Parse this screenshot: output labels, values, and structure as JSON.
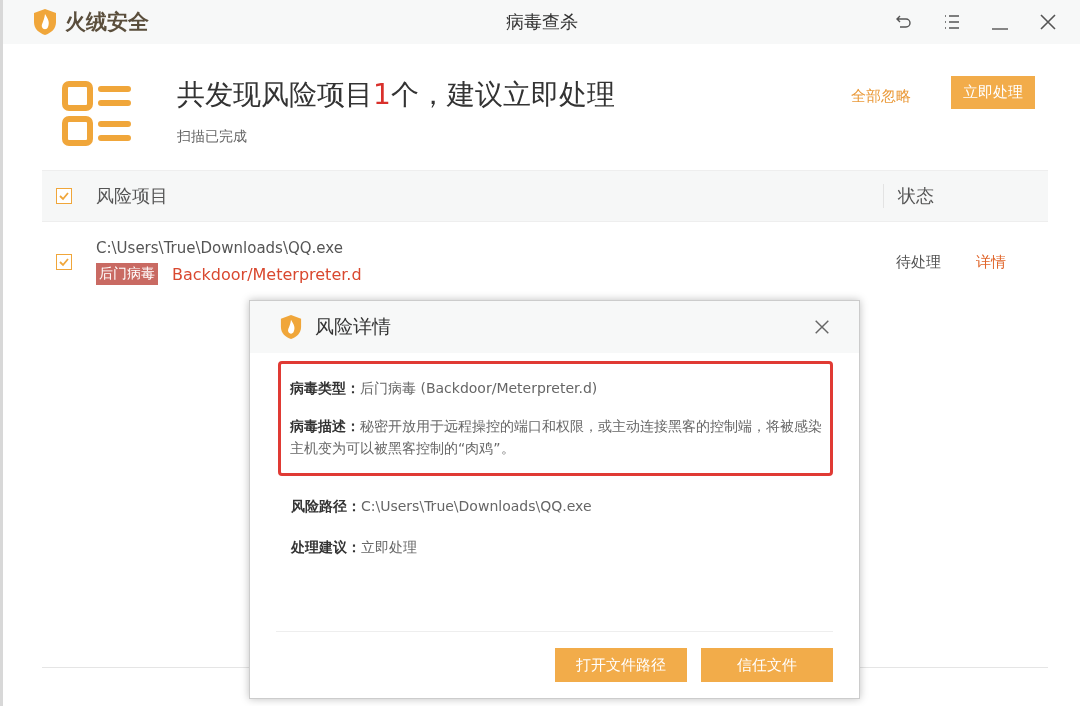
{
  "window": {
    "brand": "火绒安全",
    "title": "病毒查杀"
  },
  "summary": {
    "title_before": "共发现风险项目",
    "count": "1",
    "title_after": "个，建议立即处理",
    "subtitle": "扫描已完成"
  },
  "actions": {
    "ignore_all": "全部忽略",
    "process_now": "立即处理"
  },
  "table": {
    "header_checked": true,
    "columns": [
      "风险项目",
      "状态"
    ],
    "rows": [
      {
        "checked": true,
        "path": "C:\\Users\\True\\Downloads\\QQ.exe",
        "tag": "后门病毒",
        "virus": "Backdoor/Meterpreter.d",
        "status": "待处理",
        "link": "详情"
      }
    ]
  },
  "dialog": {
    "title": "风险详情",
    "highlighted": [
      "**病毒类型：**后门病毒 (Backdoor/Meterpreter.d)",
      "**病毒描述：**秘密开放用于远程操控的端口和权限，或主动连接黑客的控制端，将被感染主机变为可以被黑客控制的“肉鸡”。"
    ],
    "details": [
      "**风险路径：**C:\\Users\\True\\Downloads\\QQ.exe",
      "**处理建议：**立即处理"
    ],
    "buttons": [
      "打开文件路径",
      "信任文件"
    ]
  }
}
